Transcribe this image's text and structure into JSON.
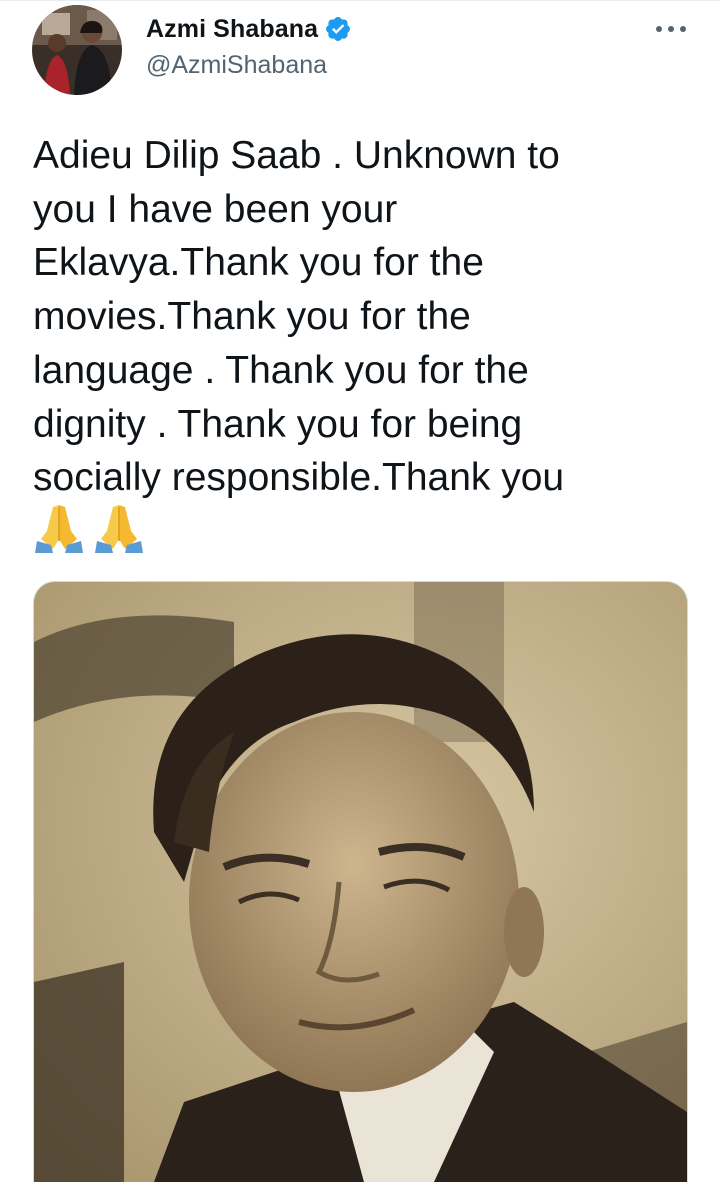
{
  "author": {
    "display_name": "Azmi Shabana",
    "handle": "@AzmiShabana",
    "verified": true,
    "avatar_icon": "profile-photo",
    "verified_icon": "verified-badge-icon"
  },
  "tweet": {
    "lines": [
      "Adieu Dilip Saab . Unknown to",
      "you I have been your",
      "Eklavya.Thank you for the",
      "movies.Thank you for the",
      "language . Thank you for the",
      "dignity . Thank you for being",
      "socially responsible.Thank you"
    ],
    "emojis": [
      "🙏",
      "🙏"
    ],
    "media_icon": "attached-photo"
  },
  "colors": {
    "text": "#0f1419",
    "secondary_text": "#536471",
    "verified_blue": "#1d9bf0",
    "border": "#cfd9de",
    "photo_sepia": "#c9b790"
  },
  "icons": {
    "more": "more-options-icon",
    "pray": "folded-hands-emoji"
  }
}
